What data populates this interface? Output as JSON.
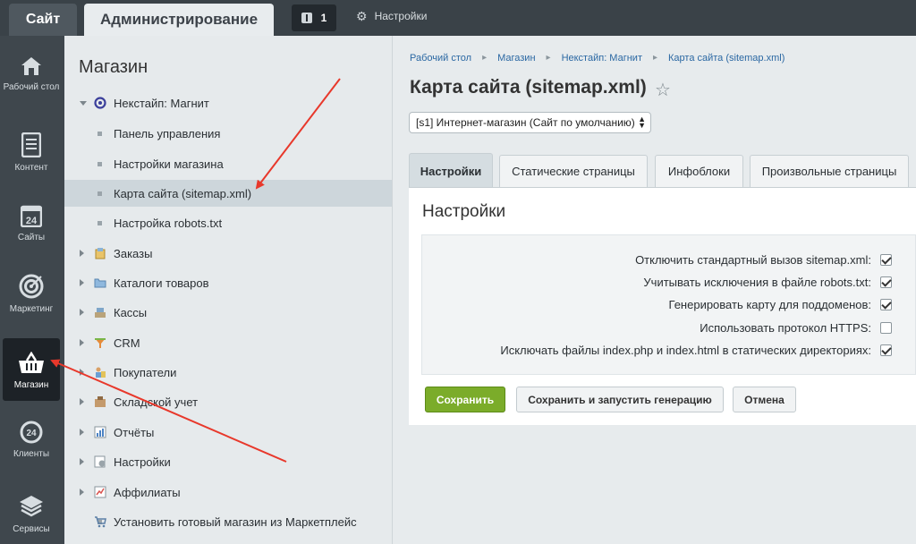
{
  "topbar": {
    "site_tab": "Сайт",
    "admin_tab": "Администрирование",
    "notifications_count": "1",
    "settings_label": "Настройки"
  },
  "rail": [
    {
      "label": "Рабочий стол",
      "icon": "home-icon"
    },
    {
      "label": "Контент",
      "icon": "document-icon"
    },
    {
      "label": "Сайты",
      "icon": "calendar-24-icon"
    },
    {
      "label": "Маркетинг",
      "icon": "target-icon"
    },
    {
      "label": "Магазин",
      "icon": "basket-icon"
    },
    {
      "label": "Клиенты",
      "icon": "clients-24-icon"
    },
    {
      "label": "Сервисы",
      "icon": "layers-icon"
    }
  ],
  "submenu": {
    "title": "Магазин",
    "items": [
      {
        "label": "Некстайп: Магнит",
        "icon": "target-circle-icon"
      },
      {
        "label": "Панель управления"
      },
      {
        "label": "Настройки магазина"
      },
      {
        "label": "Карта сайта (sitemap.xml)"
      },
      {
        "label": "Настройка robots.txt"
      },
      {
        "label": "Заказы",
        "icon": "orders-icon"
      },
      {
        "label": "Каталоги товаров",
        "icon": "folder-icon"
      },
      {
        "label": "Кассы",
        "icon": "cash-register-icon"
      },
      {
        "label": "CRM",
        "icon": "funnel-icon"
      },
      {
        "label": "Покупатели",
        "icon": "customers-icon"
      },
      {
        "label": "Складской учет",
        "icon": "warehouse-icon"
      },
      {
        "label": "Отчёты",
        "icon": "reports-icon"
      },
      {
        "label": "Настройки",
        "icon": "settings-icon"
      },
      {
        "label": "Аффилиаты",
        "icon": "affiliates-icon"
      },
      {
        "label": "Установить готовый магазин из Маркетплейс",
        "icon": "cart-icon"
      }
    ]
  },
  "breadcrumb": [
    "Рабочий стол",
    "Магазин",
    "Некстайп: Магнит",
    "Карта сайта (sitemap.xml)"
  ],
  "page_title": "Карта сайта (sitemap.xml)",
  "site_select": "[s1] Интернет-магазин (Сайт по умолчанию)",
  "tabs": [
    "Настройки",
    "Статические страницы",
    "Инфоблоки",
    "Произвольные страницы"
  ],
  "panel": {
    "title": "Настройки",
    "options": [
      {
        "label": "Отключить стандартный вызов sitemap.xml:",
        "checked": true
      },
      {
        "label": "Учитывать исключения в файле robots.txt:",
        "checked": true
      },
      {
        "label": "Генерировать карту для поддоменов:",
        "checked": true
      },
      {
        "label": "Использовать протокол HTTPS:",
        "checked": false
      },
      {
        "label": "Исключать файлы index.php и index.html в статических директориях:",
        "checked": true
      }
    ]
  },
  "buttons": {
    "save": "Сохранить",
    "save_generate": "Сохранить и запустить генерацию",
    "cancel": "Отмена"
  },
  "colors": {
    "annotation_arrow": "#e8382b",
    "save_button": "#7bac2a",
    "link": "#2b68a3"
  }
}
